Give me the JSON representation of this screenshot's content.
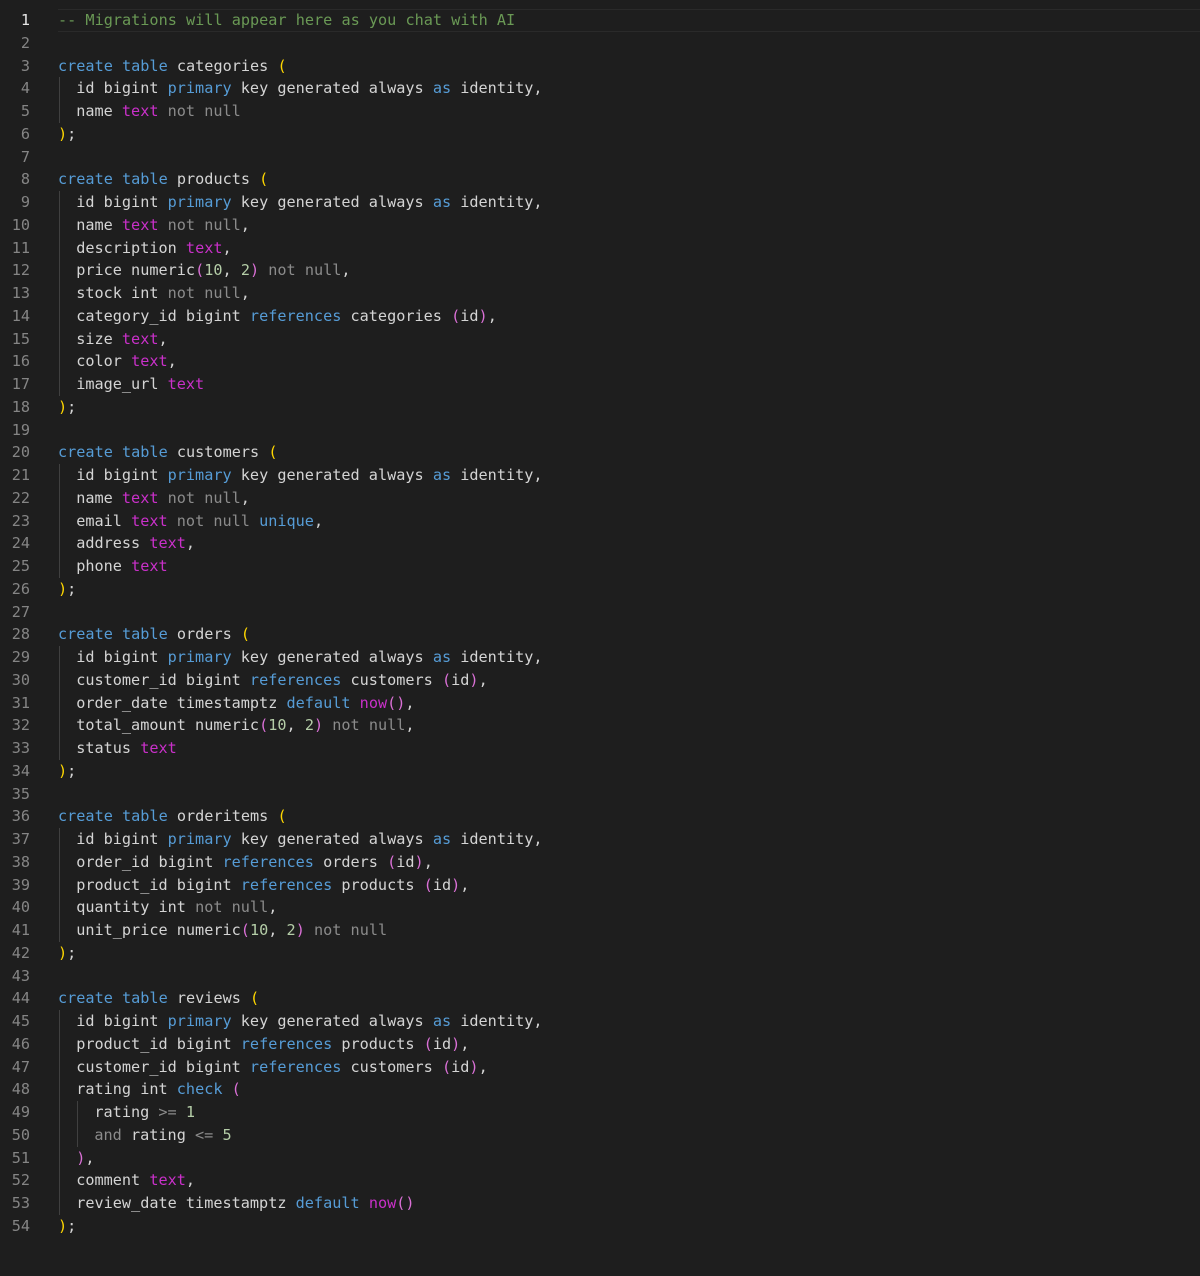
{
  "editor": {
    "language": "sql",
    "colors": {
      "background": "#1e1e1e",
      "keyword": "#569cd6",
      "type": "#c930c9",
      "muted": "#8b8b8b",
      "paren_outer": "#ffd700",
      "paren_inner": "#da70d6",
      "number": "#b5cea8",
      "comment": "#6a9955"
    },
    "active_line": 1,
    "lines": [
      {
        "n": "1",
        "indent": 0,
        "tokens": [
          [
            "cm",
            "-- Migrations will appear here as you chat with AI"
          ]
        ]
      },
      {
        "n": "2",
        "indent": 0,
        "tokens": []
      },
      {
        "n": "3",
        "indent": 0,
        "tokens": [
          [
            "kw",
            "create table"
          ],
          [
            "id",
            " categories "
          ],
          [
            "pa",
            "("
          ]
        ]
      },
      {
        "n": "4",
        "indent": 1,
        "tokens": [
          [
            "id",
            "id bigint "
          ],
          [
            "kw",
            "primary"
          ],
          [
            "id",
            " key generated always "
          ],
          [
            "kw",
            "as"
          ],
          [
            "id",
            " identity,"
          ]
        ]
      },
      {
        "n": "5",
        "indent": 1,
        "tokens": [
          [
            "id",
            "name "
          ],
          [
            "ty",
            "text"
          ],
          [
            "mu",
            " not null"
          ]
        ]
      },
      {
        "n": "6",
        "indent": 0,
        "tokens": [
          [
            "pa",
            ")"
          ],
          [
            "id",
            ";"
          ]
        ]
      },
      {
        "n": "7",
        "indent": 0,
        "tokens": []
      },
      {
        "n": "8",
        "indent": 0,
        "tokens": [
          [
            "kw",
            "create table"
          ],
          [
            "id",
            " products "
          ],
          [
            "pa",
            "("
          ]
        ]
      },
      {
        "n": "9",
        "indent": 1,
        "tokens": [
          [
            "id",
            "id bigint "
          ],
          [
            "kw",
            "primary"
          ],
          [
            "id",
            " key generated always "
          ],
          [
            "kw",
            "as"
          ],
          [
            "id",
            " identity,"
          ]
        ]
      },
      {
        "n": "10",
        "indent": 1,
        "tokens": [
          [
            "id",
            "name "
          ],
          [
            "ty",
            "text"
          ],
          [
            "mu",
            " not null"
          ],
          [
            "id",
            ","
          ]
        ]
      },
      {
        "n": "11",
        "indent": 1,
        "tokens": [
          [
            "id",
            "description "
          ],
          [
            "ty",
            "text"
          ],
          [
            "id",
            ","
          ]
        ]
      },
      {
        "n": "12",
        "indent": 1,
        "tokens": [
          [
            "id",
            "price numeric"
          ],
          [
            "pb",
            "("
          ],
          [
            "nu",
            "10"
          ],
          [
            "id",
            ", "
          ],
          [
            "nu",
            "2"
          ],
          [
            "pb",
            ")"
          ],
          [
            "mu",
            " not null"
          ],
          [
            "id",
            ","
          ]
        ]
      },
      {
        "n": "13",
        "indent": 1,
        "tokens": [
          [
            "id",
            "stock int "
          ],
          [
            "mu",
            "not null"
          ],
          [
            "id",
            ","
          ]
        ]
      },
      {
        "n": "14",
        "indent": 1,
        "tokens": [
          [
            "id",
            "category_id bigint "
          ],
          [
            "kw",
            "references"
          ],
          [
            "id",
            " categories "
          ],
          [
            "pb",
            "("
          ],
          [
            "id",
            "id"
          ],
          [
            "pb",
            ")"
          ],
          [
            "id",
            ","
          ]
        ]
      },
      {
        "n": "15",
        "indent": 1,
        "tokens": [
          [
            "id",
            "size "
          ],
          [
            "ty",
            "text"
          ],
          [
            "id",
            ","
          ]
        ]
      },
      {
        "n": "16",
        "indent": 1,
        "tokens": [
          [
            "id",
            "color "
          ],
          [
            "ty",
            "text"
          ],
          [
            "id",
            ","
          ]
        ]
      },
      {
        "n": "17",
        "indent": 1,
        "tokens": [
          [
            "id",
            "image_url "
          ],
          [
            "ty",
            "text"
          ]
        ]
      },
      {
        "n": "18",
        "indent": 0,
        "tokens": [
          [
            "pa",
            ")"
          ],
          [
            "id",
            ";"
          ]
        ]
      },
      {
        "n": "19",
        "indent": 0,
        "tokens": []
      },
      {
        "n": "20",
        "indent": 0,
        "tokens": [
          [
            "kw",
            "create table"
          ],
          [
            "id",
            " customers "
          ],
          [
            "pa",
            "("
          ]
        ]
      },
      {
        "n": "21",
        "indent": 1,
        "tokens": [
          [
            "id",
            "id bigint "
          ],
          [
            "kw",
            "primary"
          ],
          [
            "id",
            " key generated always "
          ],
          [
            "kw",
            "as"
          ],
          [
            "id",
            " identity,"
          ]
        ]
      },
      {
        "n": "22",
        "indent": 1,
        "tokens": [
          [
            "id",
            "name "
          ],
          [
            "ty",
            "text"
          ],
          [
            "mu",
            " not null"
          ],
          [
            "id",
            ","
          ]
        ]
      },
      {
        "n": "23",
        "indent": 1,
        "tokens": [
          [
            "id",
            "email "
          ],
          [
            "ty",
            "text"
          ],
          [
            "mu",
            " not null "
          ],
          [
            "kw",
            "unique"
          ],
          [
            "id",
            ","
          ]
        ]
      },
      {
        "n": "24",
        "indent": 1,
        "tokens": [
          [
            "id",
            "address "
          ],
          [
            "ty",
            "text"
          ],
          [
            "id",
            ","
          ]
        ]
      },
      {
        "n": "25",
        "indent": 1,
        "tokens": [
          [
            "id",
            "phone "
          ],
          [
            "ty",
            "text"
          ]
        ]
      },
      {
        "n": "26",
        "indent": 0,
        "tokens": [
          [
            "pa",
            ")"
          ],
          [
            "id",
            ";"
          ]
        ]
      },
      {
        "n": "27",
        "indent": 0,
        "tokens": []
      },
      {
        "n": "28",
        "indent": 0,
        "tokens": [
          [
            "kw",
            "create table"
          ],
          [
            "id",
            " orders "
          ],
          [
            "pa",
            "("
          ]
        ]
      },
      {
        "n": "29",
        "indent": 1,
        "tokens": [
          [
            "id",
            "id bigint "
          ],
          [
            "kw",
            "primary"
          ],
          [
            "id",
            " key generated always "
          ],
          [
            "kw",
            "as"
          ],
          [
            "id",
            " identity,"
          ]
        ]
      },
      {
        "n": "30",
        "indent": 1,
        "tokens": [
          [
            "id",
            "customer_id bigint "
          ],
          [
            "kw",
            "references"
          ],
          [
            "id",
            " customers "
          ],
          [
            "pb",
            "("
          ],
          [
            "id",
            "id"
          ],
          [
            "pb",
            ")"
          ],
          [
            "id",
            ","
          ]
        ]
      },
      {
        "n": "31",
        "indent": 1,
        "tokens": [
          [
            "id",
            "order_date timestamptz "
          ],
          [
            "kw",
            "default"
          ],
          [
            "id",
            " "
          ],
          [
            "ty",
            "now"
          ],
          [
            "pb",
            "()"
          ],
          [
            "id",
            ","
          ]
        ]
      },
      {
        "n": "32",
        "indent": 1,
        "tokens": [
          [
            "id",
            "total_amount numeric"
          ],
          [
            "pb",
            "("
          ],
          [
            "nu",
            "10"
          ],
          [
            "id",
            ", "
          ],
          [
            "nu",
            "2"
          ],
          [
            "pb",
            ")"
          ],
          [
            "mu",
            " not null"
          ],
          [
            "id",
            ","
          ]
        ]
      },
      {
        "n": "33",
        "indent": 1,
        "tokens": [
          [
            "id",
            "status "
          ],
          [
            "ty",
            "text"
          ]
        ]
      },
      {
        "n": "34",
        "indent": 0,
        "tokens": [
          [
            "pa",
            ")"
          ],
          [
            "id",
            ";"
          ]
        ]
      },
      {
        "n": "35",
        "indent": 0,
        "tokens": []
      },
      {
        "n": "36",
        "indent": 0,
        "tokens": [
          [
            "kw",
            "create table"
          ],
          [
            "id",
            " orderitems "
          ],
          [
            "pa",
            "("
          ]
        ]
      },
      {
        "n": "37",
        "indent": 1,
        "tokens": [
          [
            "id",
            "id bigint "
          ],
          [
            "kw",
            "primary"
          ],
          [
            "id",
            " key generated always "
          ],
          [
            "kw",
            "as"
          ],
          [
            "id",
            " identity,"
          ]
        ]
      },
      {
        "n": "38",
        "indent": 1,
        "tokens": [
          [
            "id",
            "order_id bigint "
          ],
          [
            "kw",
            "references"
          ],
          [
            "id",
            " orders "
          ],
          [
            "pb",
            "("
          ],
          [
            "id",
            "id"
          ],
          [
            "pb",
            ")"
          ],
          [
            "id",
            ","
          ]
        ]
      },
      {
        "n": "39",
        "indent": 1,
        "tokens": [
          [
            "id",
            "product_id bigint "
          ],
          [
            "kw",
            "references"
          ],
          [
            "id",
            " products "
          ],
          [
            "pb",
            "("
          ],
          [
            "id",
            "id"
          ],
          [
            "pb",
            ")"
          ],
          [
            "id",
            ","
          ]
        ]
      },
      {
        "n": "40",
        "indent": 1,
        "tokens": [
          [
            "id",
            "quantity int "
          ],
          [
            "mu",
            "not null"
          ],
          [
            "id",
            ","
          ]
        ]
      },
      {
        "n": "41",
        "indent": 1,
        "tokens": [
          [
            "id",
            "unit_price numeric"
          ],
          [
            "pb",
            "("
          ],
          [
            "nu",
            "10"
          ],
          [
            "id",
            ", "
          ],
          [
            "nu",
            "2"
          ],
          [
            "pb",
            ")"
          ],
          [
            "mu",
            " not null"
          ]
        ]
      },
      {
        "n": "42",
        "indent": 0,
        "tokens": [
          [
            "pa",
            ")"
          ],
          [
            "id",
            ";"
          ]
        ]
      },
      {
        "n": "43",
        "indent": 0,
        "tokens": []
      },
      {
        "n": "44",
        "indent": 0,
        "tokens": [
          [
            "kw",
            "create table"
          ],
          [
            "id",
            " reviews "
          ],
          [
            "pa",
            "("
          ]
        ]
      },
      {
        "n": "45",
        "indent": 1,
        "tokens": [
          [
            "id",
            "id bigint "
          ],
          [
            "kw",
            "primary"
          ],
          [
            "id",
            " key generated always "
          ],
          [
            "kw",
            "as"
          ],
          [
            "id",
            " identity,"
          ]
        ]
      },
      {
        "n": "46",
        "indent": 1,
        "tokens": [
          [
            "id",
            "product_id bigint "
          ],
          [
            "kw",
            "references"
          ],
          [
            "id",
            " products "
          ],
          [
            "pb",
            "("
          ],
          [
            "id",
            "id"
          ],
          [
            "pb",
            ")"
          ],
          [
            "id",
            ","
          ]
        ]
      },
      {
        "n": "47",
        "indent": 1,
        "tokens": [
          [
            "id",
            "customer_id bigint "
          ],
          [
            "kw",
            "references"
          ],
          [
            "id",
            " customers "
          ],
          [
            "pb",
            "("
          ],
          [
            "id",
            "id"
          ],
          [
            "pb",
            ")"
          ],
          [
            "id",
            ","
          ]
        ]
      },
      {
        "n": "48",
        "indent": 1,
        "tokens": [
          [
            "id",
            "rating int "
          ],
          [
            "kw",
            "check"
          ],
          [
            "id",
            " "
          ],
          [
            "pb",
            "("
          ]
        ]
      },
      {
        "n": "49",
        "indent": 2,
        "tokens": [
          [
            "id",
            "rating "
          ],
          [
            "op",
            ">="
          ],
          [
            "id",
            " "
          ],
          [
            "nu",
            "1"
          ]
        ]
      },
      {
        "n": "50",
        "indent": 2,
        "tokens": [
          [
            "mu",
            "and"
          ],
          [
            "id",
            " rating "
          ],
          [
            "op",
            "<="
          ],
          [
            "id",
            " "
          ],
          [
            "nu",
            "5"
          ]
        ]
      },
      {
        "n": "51",
        "indent": 1,
        "tokens": [
          [
            "pb",
            ")"
          ],
          [
            "id",
            ","
          ]
        ]
      },
      {
        "n": "52",
        "indent": 1,
        "tokens": [
          [
            "id",
            "comment "
          ],
          [
            "ty",
            "text"
          ],
          [
            "id",
            ","
          ]
        ]
      },
      {
        "n": "53",
        "indent": 1,
        "tokens": [
          [
            "id",
            "review_date timestamptz "
          ],
          [
            "kw",
            "default"
          ],
          [
            "id",
            " "
          ],
          [
            "ty",
            "now"
          ],
          [
            "pb",
            "()"
          ]
        ]
      },
      {
        "n": "54",
        "indent": 0,
        "tokens": [
          [
            "pa",
            ")"
          ],
          [
            "id",
            ";"
          ]
        ]
      }
    ]
  }
}
